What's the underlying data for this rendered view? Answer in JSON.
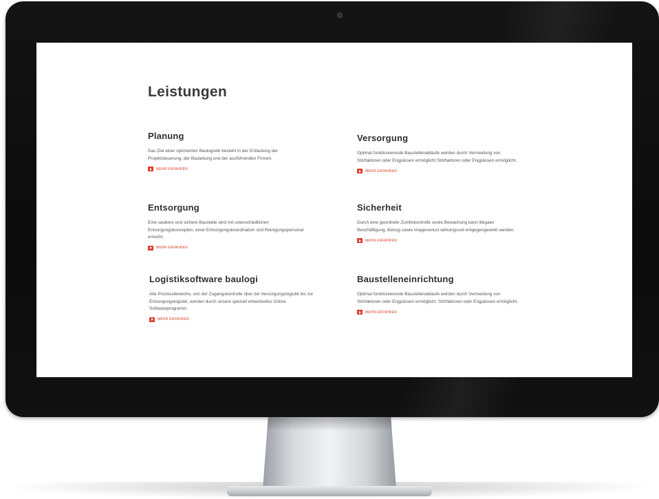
{
  "page": {
    "title": "Leistungen"
  },
  "services": [
    {
      "title": "Planung",
      "text": "Das Ziel einer optimierten Baulogistik besteht in der Entlastung der Projektsteuerung, der Bauleitung und der ausführenden Firmen.",
      "link_label": "MEHR ERFAHREN"
    },
    {
      "title": "Versorgung",
      "text": "Optimal funktionierende Baustellenabläufe werden durch Vermeidung von Störfaktoren oder Engpässen ermöglicht Störfaktoren oder Engpässen ermöglicht.",
      "link_label": "MEHR ERFAHREN"
    },
    {
      "title": "Entsorgung",
      "text": "Eine saubere und sichere Baustelle wird mit unterschiedlichen Entsorgungskonzepten, einer Entsorgungskoordination und Reinigungspersonal erreicht.",
      "link_label": "MEHR ERFAHREN"
    },
    {
      "title": "Sicherheit",
      "text": "Durch eine geordnete Zutrittskontrolle sowie Bewachung kann illegaler Beschäftigung, Betrug sowie Imageverlust wirkungsvoll entgegengewirkt werden.",
      "link_label": "MEHR ERFAHREN"
    },
    {
      "title": "Logistiksoftware baulogi",
      "text": "Alle Prozessbereiche, von der Zugangskontrolle über die Versorgungslogistik bis zur Entsorgungslogistik, werden durch unsere speziell entwickeltes Online Softwareprogramm.",
      "link_label": "MEHR ERFAHREN"
    },
    {
      "title": "Baustelleneinrichtung",
      "text": "Optimal funktionierende Baustellenabläufe werden durch Vermeidung von Störfaktoren oder Engpässen ermöglicht. Störfaktoren oder Engpässen ermöglicht.",
      "link_label": "MEHR ERFAHREN"
    }
  ],
  "icons": {
    "more_link": "arrow-right-icon",
    "camera": "camera-icon"
  },
  "colors": {
    "accent": "#d9412b",
    "heading": "#2f2f2f",
    "body_text": "#555555",
    "bezel": "#0b0b0b",
    "screen": "#ffffff"
  }
}
